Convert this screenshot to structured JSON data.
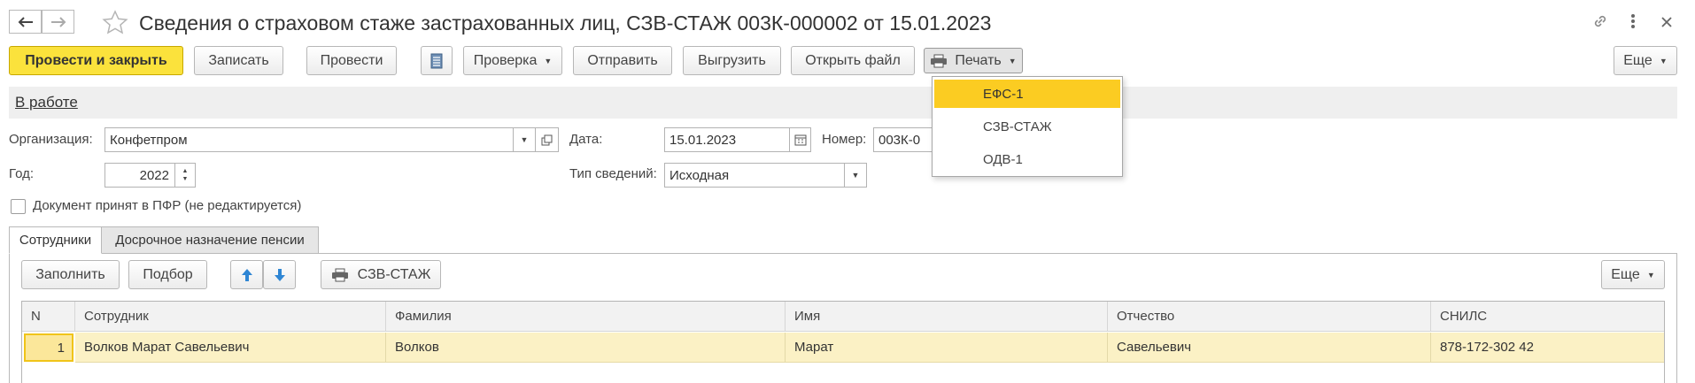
{
  "window": {
    "title": "Сведения о страховом стаже застрахованных лиц, СЗВ-СТАЖ 003К-000002 от 15.01.2023",
    "icons": [
      "back-arrow-icon",
      "forward-arrow-icon",
      "star-icon",
      "link-icon",
      "kebab-menu-icon",
      "close-icon"
    ]
  },
  "toolbar": {
    "post_close": "Провести и закрыть",
    "save": "Записать",
    "post": "Провести",
    "check": "Проверка",
    "send": "Отправить",
    "export": "Выгрузить",
    "open_file": "Открыть файл",
    "print": "Печать",
    "more": "Еще"
  },
  "print_menu": {
    "items": [
      "ЕФС-1",
      "СЗВ-СТАЖ",
      "ОДВ-1"
    ],
    "highlighted": "ЕФС-1"
  },
  "status": {
    "label": "В работе"
  },
  "form": {
    "org_label": "Организация:",
    "org_value": "Конфетпром",
    "date_label": "Дата:",
    "date_value": "15.01.2023",
    "number_label": "Номер:",
    "number_value": "003К-0",
    "year_label": "Год:",
    "year_value": "2022",
    "type_label": "Тип сведений:",
    "type_value": "Исходная",
    "pfr_checkbox_label": "Документ принят в ПФР (не редактируется)",
    "pfr_checked": false
  },
  "tabs": [
    {
      "label": "Сотрудники",
      "active": true
    },
    {
      "label": "Досрочное назначение пенсии",
      "active": false
    }
  ],
  "table_toolbar": {
    "fill": "Заполнить",
    "select": "Подбор",
    "print_szv": "СЗВ-СТАЖ",
    "more": "Еще"
  },
  "table": {
    "columns": [
      "N",
      "Сотрудник",
      "Фамилия",
      "Имя",
      "Отчество",
      "СНИЛС"
    ],
    "rows": [
      {
        "n": "1",
        "employee": "Волков Марат Савельевич",
        "last_name": "Волков",
        "first_name": "Марат",
        "patronymic": "Савельевич",
        "snils": "878-172-302 42"
      }
    ]
  },
  "colors": {
    "primary_button": "#fbe23c",
    "menu_highlight": "#fbcc22",
    "selected_row": "#fbf1c5",
    "arrow_blue": "#2f86d4"
  }
}
